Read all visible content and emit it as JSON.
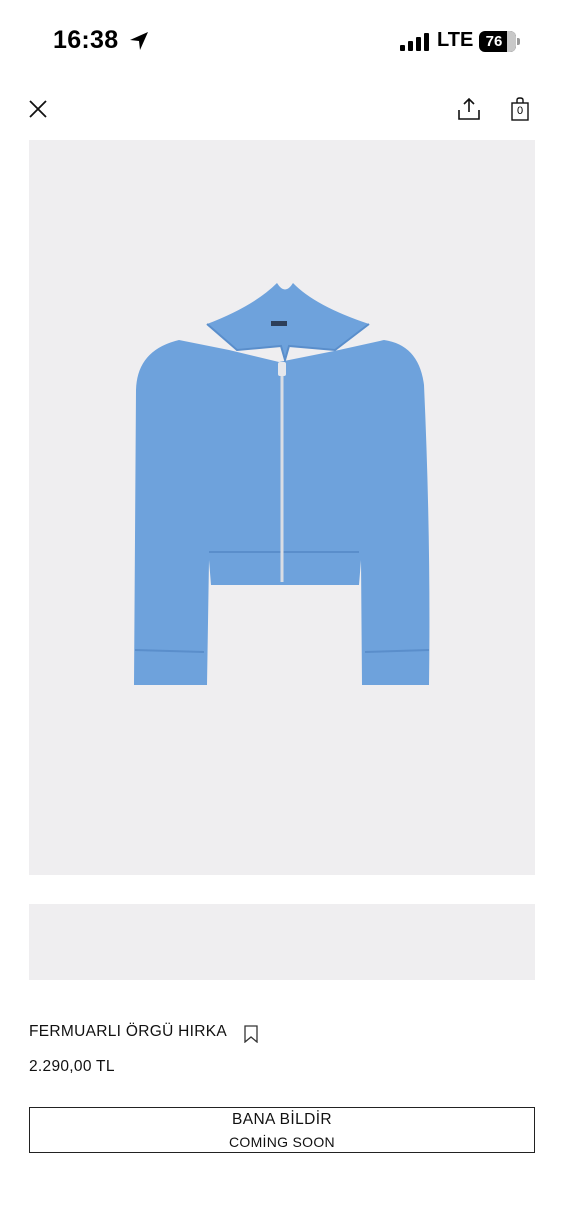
{
  "status_bar": {
    "time": "16:38",
    "network": "LTE",
    "battery_level": "76",
    "battery_fraction": 0.76,
    "icons": [
      "location-arrow-icon",
      "signal-bars-icon",
      "battery-icon"
    ]
  },
  "nav": {
    "icons": [
      "close-icon",
      "share-icon",
      "shopping-bag-icon"
    ],
    "bag_count": "0"
  },
  "product": {
    "title": "FERMUARLI ÖRGÜ HIRKA",
    "price": "2.290,00 TL",
    "bookmark_icon": "bookmark-icon",
    "sweater_color": "#6ea2dc"
  },
  "cta": {
    "label": "BANA BİLDİR",
    "sublabel": "COMİNG SOON"
  }
}
